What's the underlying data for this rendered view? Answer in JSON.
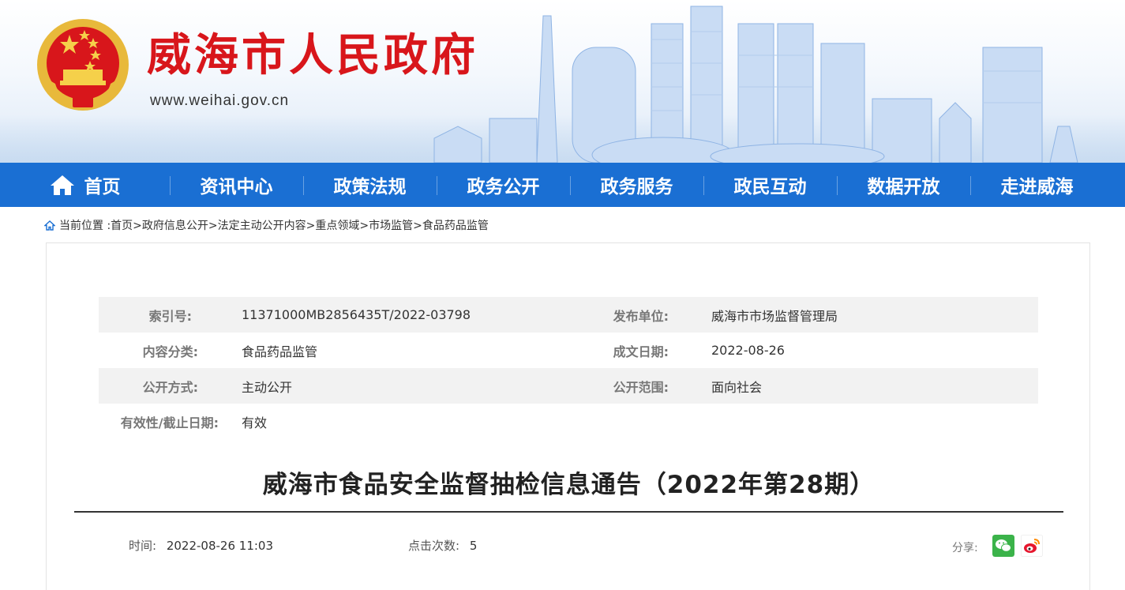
{
  "header": {
    "site_title": "威海市人民政府",
    "site_url": "www.weihai.gov.cn",
    "emblem_icon": "national-emblem-icon",
    "colors": {
      "title_red": "#d8161b",
      "nav_blue": "#1a6fd3"
    }
  },
  "nav": {
    "items": [
      {
        "label": "首页",
        "icon": "home-icon"
      },
      {
        "label": "资讯中心"
      },
      {
        "label": "政策法规"
      },
      {
        "label": "政务公开"
      },
      {
        "label": "政务服务"
      },
      {
        "label": "政民互动"
      },
      {
        "label": "数据开放"
      },
      {
        "label": "走进威海"
      }
    ]
  },
  "breadcrumb": {
    "prefix": "当前位置 :",
    "items": [
      "首页>",
      "政府信息公开>",
      "法定主动公开内容>",
      "重点领域>",
      "市场监管>",
      "食品药品监管"
    ]
  },
  "meta": {
    "index_label": "索引号:",
    "index_value": "11371000MB2856435T/2022-03798",
    "publisher_label": "发布单位:",
    "publisher_value": "威海市市场监督管理局",
    "category_label": "内容分类:",
    "category_value": "食品药品监管",
    "date_label": "成文日期:",
    "date_value": "2022-08-26",
    "method_label": "公开方式:",
    "method_value": "主动公开",
    "scope_label": "公开范围:",
    "scope_value": "面向社会",
    "validity_label": "有效性/截止日期:",
    "validity_value": "有效"
  },
  "article": {
    "title": "威海市食品安全监督抽检信息通告（2022年第28期）",
    "time_label": "时间:",
    "time_value": "2022-08-26 11:03",
    "clicks_label": "点击次数:",
    "clicks_value": "5",
    "share_label": "分享:",
    "share_icons": [
      "wechat-icon",
      "weibo-icon"
    ]
  }
}
